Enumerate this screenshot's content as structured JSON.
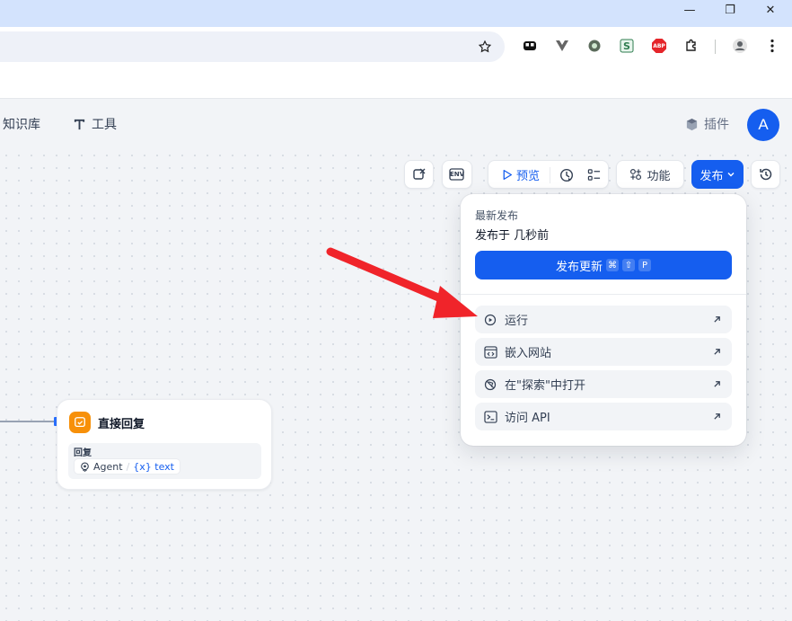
{
  "browser": {
    "window_controls": {
      "minimize": "—",
      "restore": "❐",
      "close": "✕"
    },
    "extensions": [
      "toolbar-ext-1",
      "toolbar-ext-2",
      "toolbar-ext-3",
      "toolbar-ext-s",
      "adblock-ext",
      "puzzle-ext"
    ],
    "adblock_label": "ABP",
    "s_label": "S"
  },
  "header": {
    "nav": [
      {
        "label": "知识库"
      },
      {
        "label": "工具"
      }
    ],
    "plugins_label": "插件",
    "avatar_initial": "A"
  },
  "toolbar": {
    "preview_label": "预览",
    "features_label": "功能",
    "publish_label": "发布",
    "env_label": "ENV"
  },
  "node": {
    "title": "直接回复",
    "field_label": "回复",
    "var_source": "Agent",
    "var_separator": "/",
    "var_name": "{x} text"
  },
  "publish_menu": {
    "latest_label": "最新发布",
    "published_time": "发布于 几秒前",
    "update_button": "发布更新",
    "shortcut": [
      "⌘",
      "⇧",
      "P"
    ],
    "items": [
      {
        "label": "运行"
      },
      {
        "label": "嵌入网站"
      },
      {
        "label": "在\"探索\"中打开"
      },
      {
        "label": "访问 API"
      }
    ]
  },
  "colors": {
    "accent": "#155eef",
    "node_icon": "#f79009",
    "annotation_arrow": "#f0242a"
  }
}
